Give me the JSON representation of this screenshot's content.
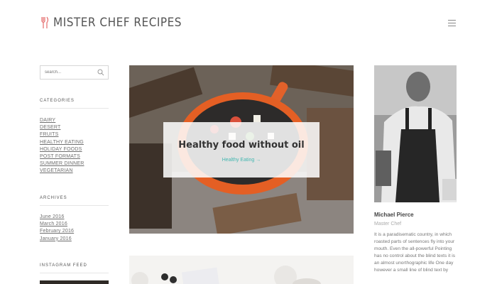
{
  "header": {
    "logo_text": "MISTER CHEF RECIPES",
    "logo_icon": "fork-knife-icon",
    "menu_icon": "hamburger-icon"
  },
  "search": {
    "placeholder": "search..."
  },
  "categories": {
    "title": "CATEGORIES",
    "items": [
      "DAIRY",
      "DESERT",
      "FRUITS",
      "HEALTHY EATING",
      "HOLIDAY FOODS",
      "POST FORMATS",
      "SUMMER DINNER",
      "VEGETARIAN"
    ]
  },
  "archives": {
    "title": "ARCHIVES",
    "items": [
      "June 2016",
      "March 2016",
      "February 2016",
      "January 2016"
    ]
  },
  "instagram": {
    "title": "INSTAGRAM FEED"
  },
  "feature": {
    "title": "Healthy food without oil",
    "category": "Healthy Eating",
    "category_arrow": "→"
  },
  "author": {
    "name": "Michael Pierce",
    "role": "Master Chef",
    "bio": "It is a paradisematic country, in which roasted parts of sentences fly into your mouth. Even the all-powerful Pointing has no control about the blind texts it is an almost unorthographic life One day however a small line of blind text by"
  },
  "colors": {
    "accent": "#e46b6b",
    "link_teal": "#42b7b0"
  }
}
